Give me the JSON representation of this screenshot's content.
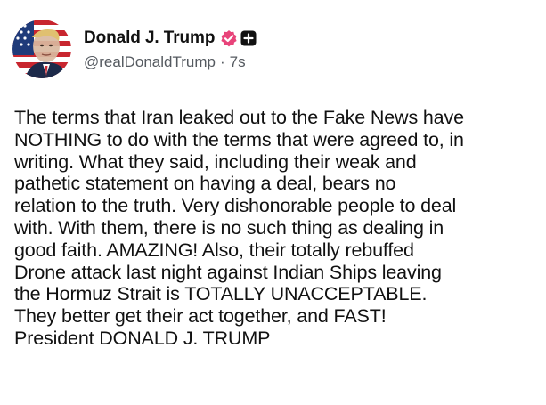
{
  "author": {
    "display_name": "Donald J. Trump",
    "handle": "@realDonaldTrump",
    "separator": "·",
    "time_ago": "7s",
    "verified_badge_color": "#e8447a",
    "verified_icon": "verified-check-icon",
    "plus_icon": "plus-badge-icon"
  },
  "post": {
    "lines": [
      "The terms that Iran leaked out to the Fake News have",
      "NOTHING to do with the terms that were agreed to, in",
      "writing. What they said, including their weak and",
      "pathetic statement on having a deal, bears no",
      "relation to the truth. Very dishonorable people to deal",
      "with. With them, there is no such thing as dealing in",
      "good faith. AMAZING! Also, their totally rebuffed",
      "Drone attack last night against Indian Ships leaving",
      "the Hormuz Strait is TOTALLY UNACCEPTABLE.",
      "They better get their act together, and FAST!",
      "President DONALD J. TRUMP"
    ]
  }
}
